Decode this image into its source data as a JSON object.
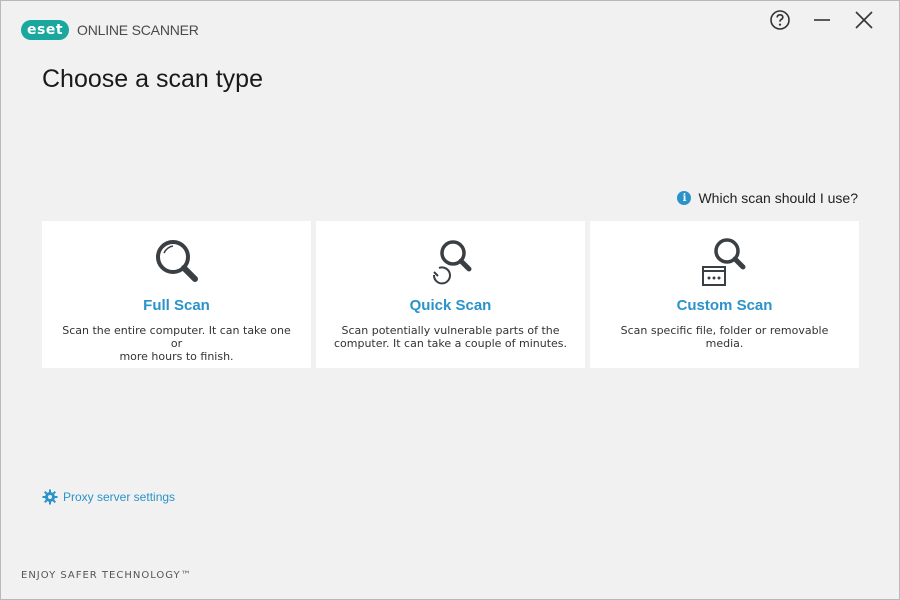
{
  "titlebar": {
    "logo_badge": "eset",
    "logo_text": "ONLINE SCANNER",
    "controls": [
      "help-icon",
      "minimize-icon",
      "close-icon"
    ]
  },
  "page": {
    "title": "Choose a scan type"
  },
  "help": {
    "label": "Which scan should I use?",
    "icon": "info-icon"
  },
  "scans": [
    {
      "icon": "magnifier-icon",
      "title": "Full Scan",
      "description_line1": "Scan the entire computer. It can take one or",
      "description_line2": "more hours to finish."
    },
    {
      "icon": "quick-scan-icon",
      "title": "Quick Scan",
      "description_line1": "Scan potentially vulnerable parts of the",
      "description_line2": "computer. It can take a couple of minutes."
    },
    {
      "icon": "custom-scan-icon",
      "title": "Custom Scan",
      "description_line1": "Scan specific file, folder or removable media.",
      "description_line2": ""
    }
  ],
  "proxy": {
    "label": "Proxy server settings",
    "icon": "gear-icon"
  },
  "footer": {
    "tagline": "ENJOY SAFER TECHNOLOGY™"
  },
  "colors": {
    "accent": "#2a93c9",
    "brand": "#1aa79d",
    "background": "#f0f0f0",
    "card": "#ffffff"
  }
}
